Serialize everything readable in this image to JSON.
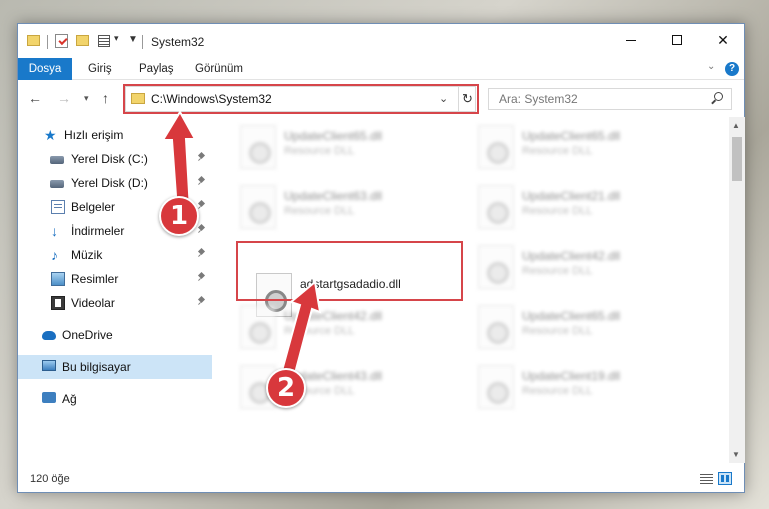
{
  "window": {
    "title": "System32",
    "title_icons": [
      "folder-icon",
      "properties-icon",
      "new-folder-icon",
      "view-icon",
      "dropdown-icon",
      "down-arrow-icon"
    ]
  },
  "ribbon": {
    "tabs": [
      {
        "label": "Dosya",
        "active": true
      },
      {
        "label": "Giriş"
      },
      {
        "label": "Paylaş"
      },
      {
        "label": "Görünüm"
      }
    ],
    "help_label": "?",
    "accent_color": "#1979ca"
  },
  "navbar": {
    "address": "C:\\Windows\\System32",
    "search_placeholder": "Ara: System32"
  },
  "sidebar": {
    "items": [
      {
        "label": "Hızlı erişim",
        "icon": "star-icon"
      },
      {
        "label": "Yerel Disk (C:)",
        "icon": "disk-icon",
        "pinned": true
      },
      {
        "label": "Yerel Disk (D:)",
        "icon": "disk-icon",
        "pinned": true
      },
      {
        "label": "Belgeler",
        "icon": "document-icon",
        "pinned": true
      },
      {
        "label": "İndirmeler",
        "icon": "download-icon",
        "pinned": true
      },
      {
        "label": "Müzik",
        "icon": "music-icon",
        "pinned": true
      },
      {
        "label": "Resimler",
        "icon": "pictures-icon",
        "pinned": true
      },
      {
        "label": "Videolar",
        "icon": "video-icon",
        "pinned": true
      },
      {
        "label": "OneDrive",
        "icon": "cloud-icon"
      },
      {
        "label": "Bu bilgisayar",
        "icon": "computer-icon",
        "selected": true
      },
      {
        "label": "Ağ",
        "icon": "network-icon"
      }
    ],
    "selected_color": "#cce4f7"
  },
  "files": [
    {
      "name": "UpdateClient65.dll",
      "type": "Resource DLL"
    },
    {
      "name": "UpdateClient65.dll",
      "type": "Resource DLL"
    },
    {
      "name": "UpdateClient63.dll",
      "type": "Resource DLL"
    },
    {
      "name": "UpdateClient21.dll",
      "type": "Resource DLL"
    },
    {
      "name": "adstartgsadadio.dll",
      "type": ""
    },
    {
      "name": "UpdateClient42.dll",
      "type": "Resource DLL"
    },
    {
      "name": "UpdateClient42.dll",
      "type": "Resource DLL"
    },
    {
      "name": "UpdateClient65.dll",
      "type": "Resource DLL"
    },
    {
      "name": "UpdateClient43.dll",
      "type": "Resource DLL"
    },
    {
      "name": "UpdateClient19.dll",
      "type": "Resource DLL"
    }
  ],
  "status": {
    "item_count": "120 öğe"
  },
  "annotations": {
    "step1": "1",
    "step2": "2",
    "color": "#d8383c"
  }
}
